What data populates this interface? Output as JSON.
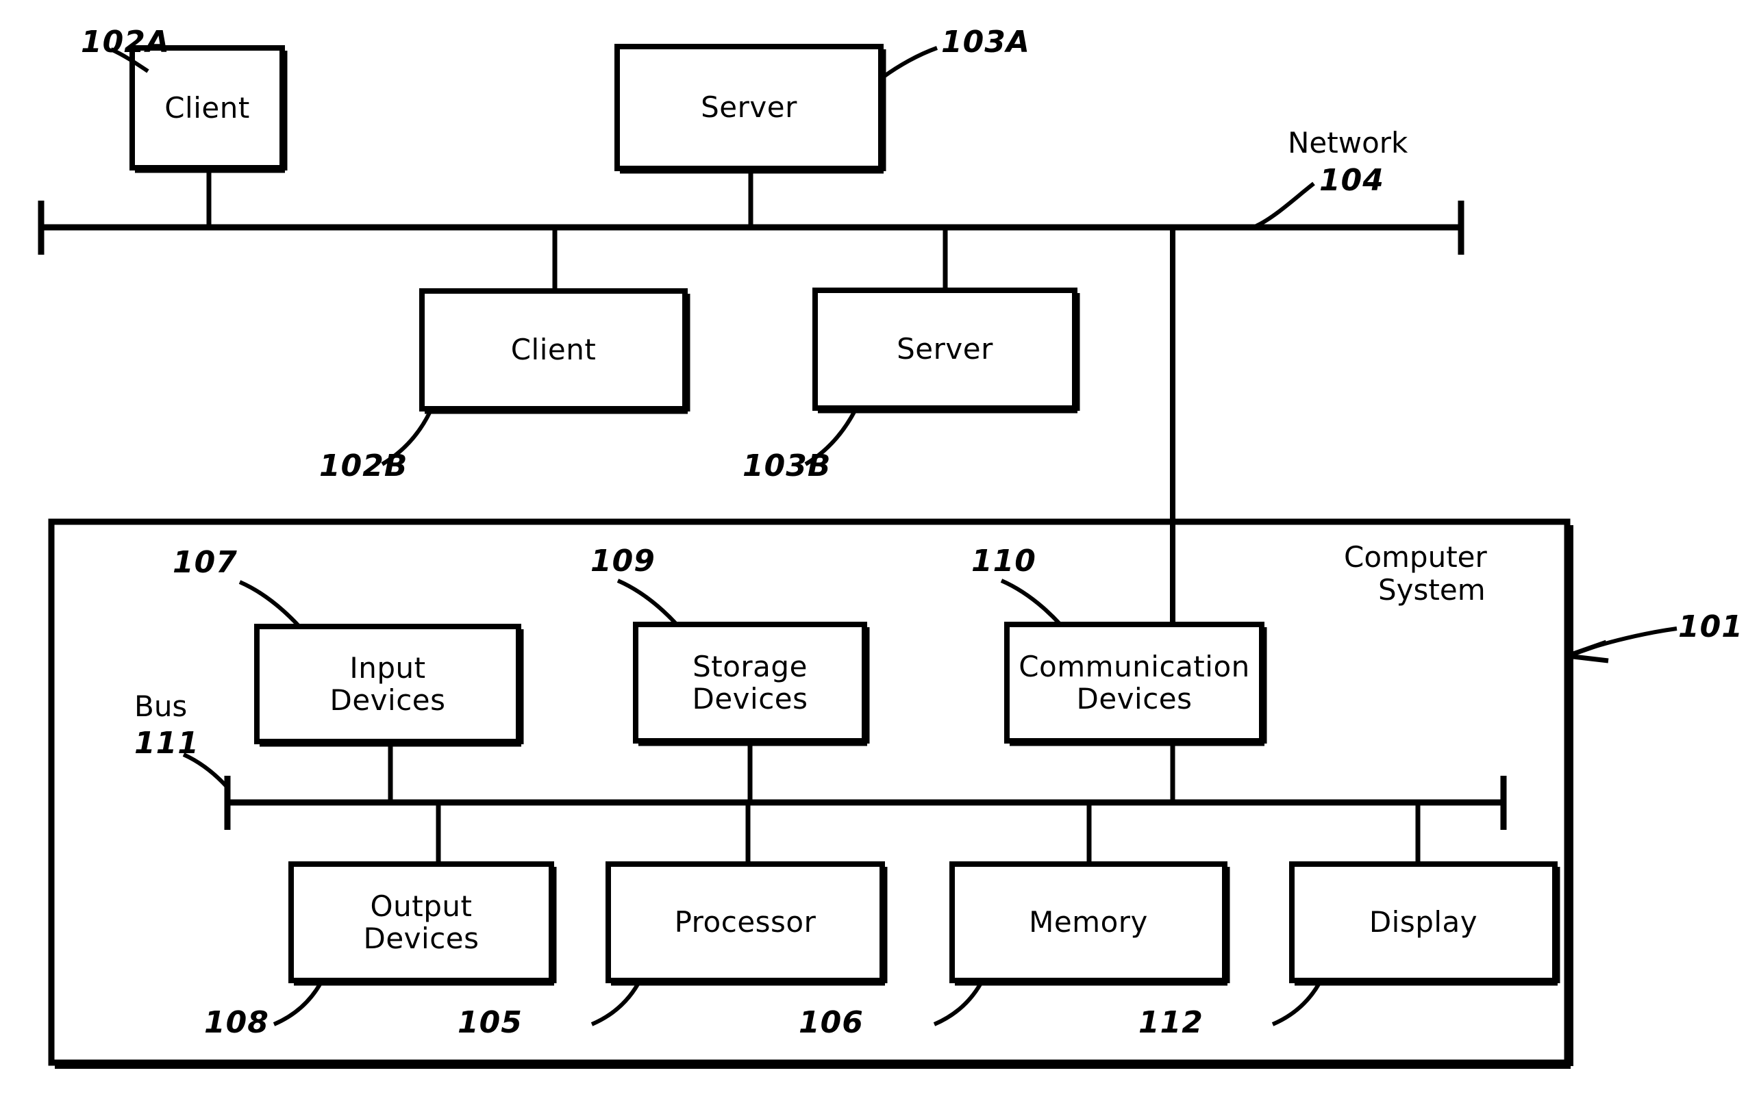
{
  "figure": {
    "title": "Computer system and network block diagram",
    "stroke_color": "#000000",
    "background_color": "#ffffff"
  },
  "network": {
    "label": "Network",
    "ref": "104"
  },
  "top_nodes": [
    {
      "label": "Client",
      "ref": "102A"
    },
    {
      "label": "Server",
      "ref": "103A"
    },
    {
      "label": "Client",
      "ref": "102B"
    },
    {
      "label": "Server",
      "ref": "103B"
    }
  ],
  "computer_system": {
    "label_line1": "Computer",
    "label_line2": "System",
    "ref": "101",
    "bus": {
      "label": "Bus",
      "ref": "111"
    },
    "components": [
      {
        "label_line1": "Input",
        "label_line2": "Devices",
        "ref": "107"
      },
      {
        "label_line1": "Storage",
        "label_line2": "Devices",
        "ref": "109"
      },
      {
        "label_line1": "Communication",
        "label_line2": "Devices",
        "ref": "110"
      },
      {
        "label_line1": "Output",
        "label_line2": "Devices",
        "ref": "108"
      },
      {
        "label_line1": "Processor",
        "label_line2": "",
        "ref": "105"
      },
      {
        "label_line1": "Memory",
        "label_line2": "",
        "ref": "106"
      },
      {
        "label_line1": "Display",
        "label_line2": "",
        "ref": "112"
      }
    ]
  }
}
